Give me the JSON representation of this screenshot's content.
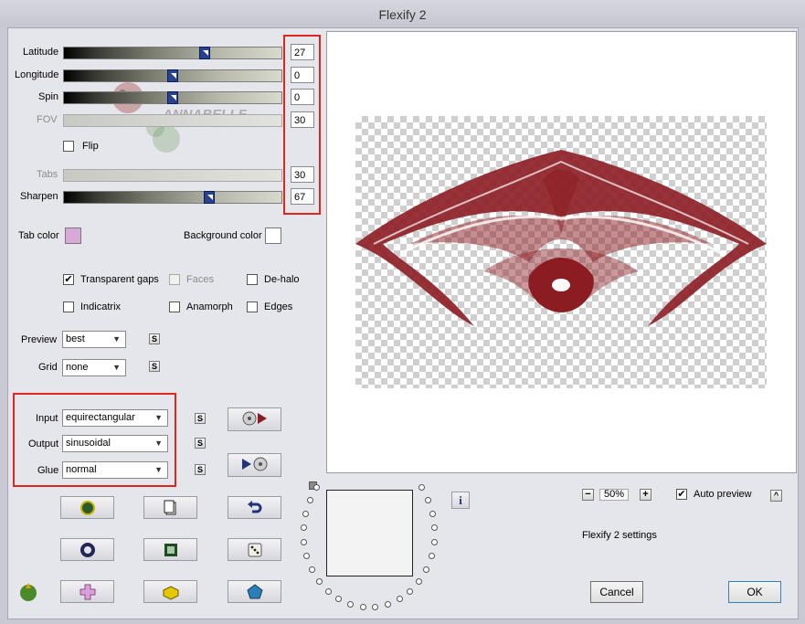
{
  "window": {
    "title": "Flexify 2"
  },
  "sliders": {
    "latitude": {
      "label": "Latitude",
      "value": "27",
      "level": 0.65
    },
    "longitude": {
      "label": "Longitude",
      "value": "0",
      "level": 0.5
    },
    "spin": {
      "label": "Spin",
      "value": "0",
      "level": 0.5
    },
    "fov": {
      "label": "FOV",
      "value": "30"
    },
    "tabs": {
      "label": "Tabs",
      "value": "30"
    },
    "sharpen": {
      "label": "Sharpen",
      "value": "67",
      "level": 0.67
    }
  },
  "flip_label": "Flip",
  "watermark": "ANNABELLE",
  "colors": {
    "tab_color_label": "Tab color",
    "tab_color": "#d8a8d8",
    "background_color_label": "Background color",
    "background_color": "#ffffff"
  },
  "options": {
    "transparent_gaps": {
      "label": "Transparent gaps",
      "checked": true
    },
    "faces": {
      "label": "Faces",
      "checked": false
    },
    "de_halo": {
      "label": "De-halo",
      "checked": false
    },
    "indicatrix": {
      "label": "Indicatrix",
      "checked": false
    },
    "anamorph": {
      "label": "Anamorph",
      "checked": false
    },
    "edges": {
      "label": "Edges",
      "checked": false
    }
  },
  "preview_select": {
    "label": "Preview",
    "value": "best"
  },
  "grid_select": {
    "label": "Grid",
    "value": "none"
  },
  "input_select": {
    "label": "Input",
    "value": "equirectangular"
  },
  "output_select": {
    "label": "Output",
    "value": "sinusoidal"
  },
  "glue_select": {
    "label": "Glue",
    "value": "normal"
  },
  "s_label": "S",
  "info_label": "i",
  "zoom": {
    "minus": "−",
    "value": "50%",
    "plus": "+"
  },
  "auto_preview": {
    "label": "Auto preview",
    "checked": true,
    "collapse": "^"
  },
  "settings_name": "Flexify 2 settings",
  "buttons": {
    "cancel": "Cancel",
    "ok": "OK"
  },
  "accent": "#e0261c",
  "shape_color": "#8b1c22"
}
